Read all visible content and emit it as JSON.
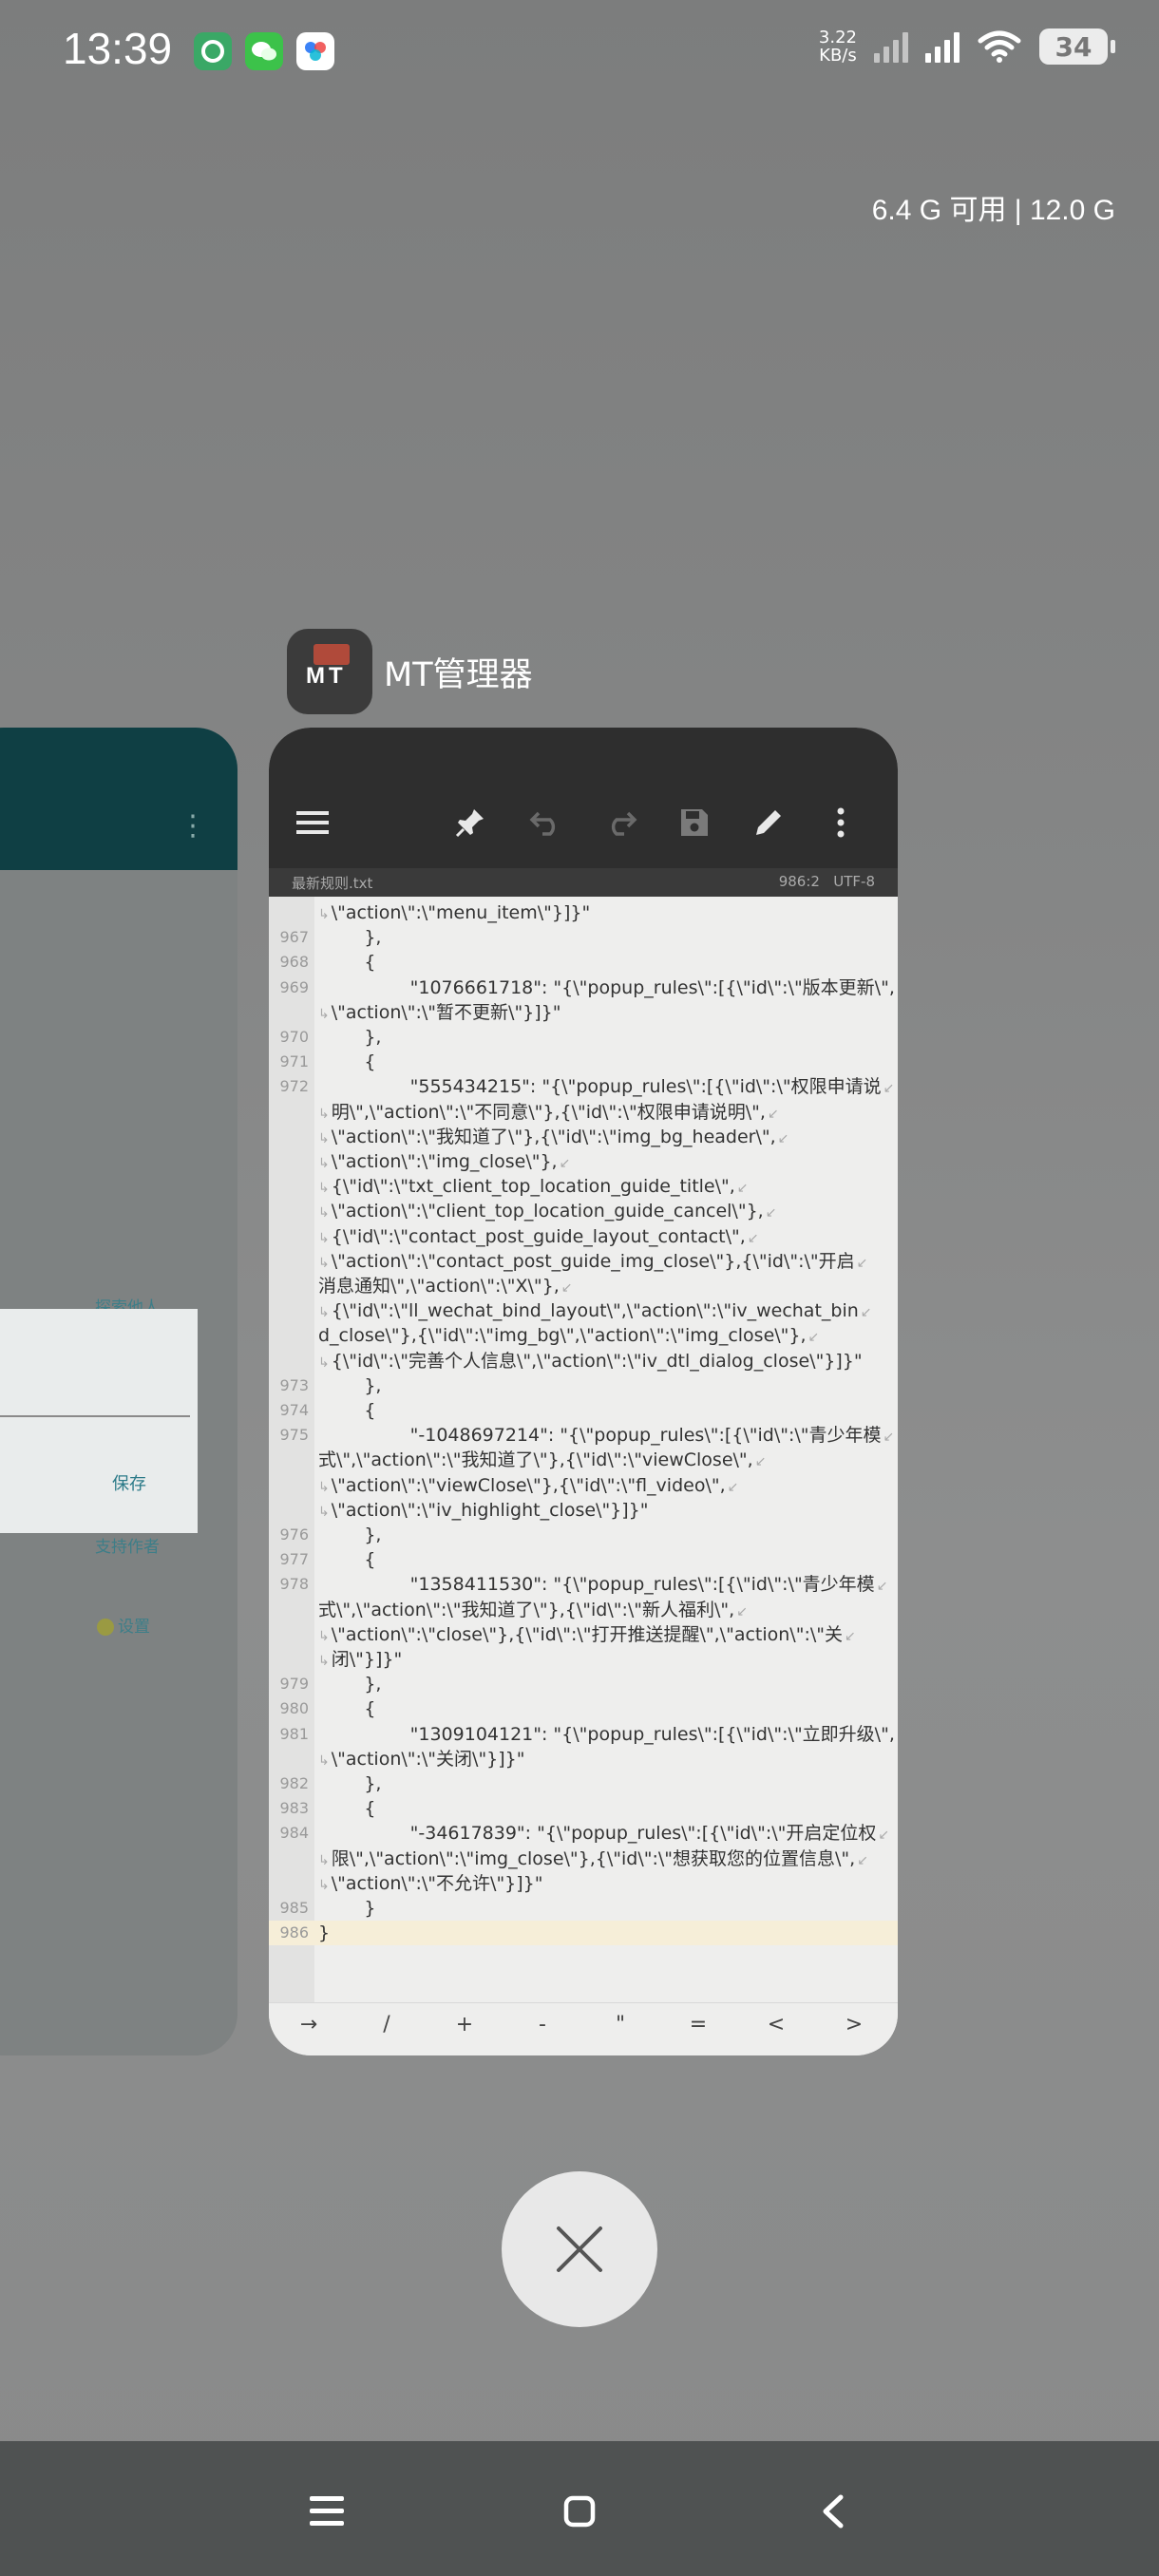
{
  "status_bar": {
    "time": "13:39",
    "app_icons": [
      "green-leaf-icon",
      "wechat-icon",
      "baidu-netdisk-icon"
    ],
    "net_speed_value": "3.22",
    "net_speed_unit": "KB/s",
    "battery": "34"
  },
  "memory": {
    "available": "6.4 G 可用",
    "total": "12.0 G"
  },
  "left_card": {
    "label_1": "探索他人",
    "save_label": "保存",
    "label_2": "支持作者",
    "settings_label": "设置"
  },
  "app": {
    "name": "MT管理器",
    "icon_text": "MT",
    "file_name": "最新规则.txt",
    "cursor_pos": "986:2",
    "encoding": "UTF-8",
    "lines": [
      {
        "n": "",
        "text": "\\\"action\\\":\\\"menu_item\\\"}]}\"",
        "wrap": true,
        "wrapEnd": false
      },
      {
        "n": "967",
        "text": "    },",
        "wrap": false,
        "wrapEnd": false
      },
      {
        "n": "968",
        "text": "    {",
        "wrap": false,
        "wrapEnd": false
      },
      {
        "n": "969",
        "text": "        \"1076661718\": \"{\\\"popup_rules\\\":[{\\\"id\\\":\\\"版本更新\\\",",
        "wrap": false,
        "wrapEnd": true
      },
      {
        "n": "",
        "text": "\\\"action\\\":\\\"暂不更新\\\"}]}\"",
        "wrap": true,
        "wrapEnd": false
      },
      {
        "n": "970",
        "text": "    },",
        "wrap": false,
        "wrapEnd": false
      },
      {
        "n": "971",
        "text": "    {",
        "wrap": false,
        "wrapEnd": false
      },
      {
        "n": "972",
        "text": "        \"555434215\": \"{\\\"popup_rules\\\":[{\\\"id\\\":\\\"权限申请说",
        "wrap": false,
        "wrapEnd": true
      },
      {
        "n": "",
        "text": "明\\\",\\\"action\\\":\\\"不同意\\\"},{\\\"id\\\":\\\"权限申请说明\\\",",
        "wrap": true,
        "wrapEnd": true
      },
      {
        "n": "",
        "text": "\\\"action\\\":\\\"我知道了\\\"},{\\\"id\\\":\\\"img_bg_header\\\",",
        "wrap": true,
        "wrapEnd": true
      },
      {
        "n": "",
        "text": "\\\"action\\\":\\\"img_close\\\"},",
        "wrap": true,
        "wrapEnd": true
      },
      {
        "n": "",
        "text": "{\\\"id\\\":\\\"txt_client_top_location_guide_title\\\",",
        "wrap": true,
        "wrapEnd": true
      },
      {
        "n": "",
        "text": "\\\"action\\\":\\\"client_top_location_guide_cancel\\\"},",
        "wrap": true,
        "wrapEnd": true
      },
      {
        "n": "",
        "text": "{\\\"id\\\":\\\"contact_post_guide_layout_contact\\\",",
        "wrap": true,
        "wrapEnd": true
      },
      {
        "n": "",
        "text": "\\\"action\\\":\\\"contact_post_guide_img_close\\\"},{\\\"id\\\":\\\"开启",
        "wrap": true,
        "wrapEnd": true
      },
      {
        "n": "",
        "text": "消息通知\\\",\\\"action\\\":\\\"X\\\"},",
        "wrap": false,
        "wrapEnd": true
      },
      {
        "n": "",
        "text": "{\\\"id\\\":\\\"ll_wechat_bind_layout\\\",\\\"action\\\":\\\"iv_wechat_bin",
        "wrap": true,
        "wrapEnd": true
      },
      {
        "n": "",
        "text": "d_close\\\"},{\\\"id\\\":\\\"img_bg\\\",\\\"action\\\":\\\"img_close\\\"},",
        "wrap": false,
        "wrapEnd": true
      },
      {
        "n": "",
        "text": "{\\\"id\\\":\\\"完善个人信息\\\",\\\"action\\\":\\\"iv_dtl_dialog_close\\\"}]}\"",
        "wrap": true,
        "wrapEnd": false
      },
      {
        "n": "973",
        "text": "    },",
        "wrap": false,
        "wrapEnd": false
      },
      {
        "n": "974",
        "text": "    {",
        "wrap": false,
        "wrapEnd": false
      },
      {
        "n": "975",
        "text": "        \"-1048697214\": \"{\\\"popup_rules\\\":[{\\\"id\\\":\\\"青少年模",
        "wrap": false,
        "wrapEnd": true
      },
      {
        "n": "",
        "text": "式\\\",\\\"action\\\":\\\"我知道了\\\"},{\\\"id\\\":\\\"viewClose\\\",",
        "wrap": false,
        "wrapEnd": true
      },
      {
        "n": "",
        "text": "\\\"action\\\":\\\"viewClose\\\"},{\\\"id\\\":\\\"fl_video\\\",",
        "wrap": true,
        "wrapEnd": true
      },
      {
        "n": "",
        "text": "\\\"action\\\":\\\"iv_highlight_close\\\"}]}\"",
        "wrap": true,
        "wrapEnd": false
      },
      {
        "n": "976",
        "text": "    },",
        "wrap": false,
        "wrapEnd": false
      },
      {
        "n": "977",
        "text": "    {",
        "wrap": false,
        "wrapEnd": false
      },
      {
        "n": "978",
        "text": "        \"1358411530\": \"{\\\"popup_rules\\\":[{\\\"id\\\":\\\"青少年模",
        "wrap": false,
        "wrapEnd": true
      },
      {
        "n": "",
        "text": "式\\\",\\\"action\\\":\\\"我知道了\\\"},{\\\"id\\\":\\\"新人福利\\\",",
        "wrap": false,
        "wrapEnd": true
      },
      {
        "n": "",
        "text": "\\\"action\\\":\\\"close\\\"},{\\\"id\\\":\\\"打开推送提醒\\\",\\\"action\\\":\\\"关",
        "wrap": true,
        "wrapEnd": true
      },
      {
        "n": "",
        "text": "闭\\\"}]}\"",
        "wrap": true,
        "wrapEnd": false
      },
      {
        "n": "979",
        "text": "    },",
        "wrap": false,
        "wrapEnd": false
      },
      {
        "n": "980",
        "text": "    {",
        "wrap": false,
        "wrapEnd": false
      },
      {
        "n": "981",
        "text": "        \"1309104121\": \"{\\\"popup_rules\\\":[{\\\"id\\\":\\\"立即升级\\\",",
        "wrap": false,
        "wrapEnd": true
      },
      {
        "n": "",
        "text": "\\\"action\\\":\\\"关闭\\\"}]}\"",
        "wrap": true,
        "wrapEnd": false
      },
      {
        "n": "982",
        "text": "    },",
        "wrap": false,
        "wrapEnd": false
      },
      {
        "n": "983",
        "text": "    {",
        "wrap": false,
        "wrapEnd": false
      },
      {
        "n": "984",
        "text": "        \"-34617839\": \"{\\\"popup_rules\\\":[{\\\"id\\\":\\\"开启定位权",
        "wrap": false,
        "wrapEnd": true
      },
      {
        "n": "",
        "text": "限\\\",\\\"action\\\":\\\"img_close\\\"},{\\\"id\\\":\\\"想获取您的位置信息\\\",",
        "wrap": true,
        "wrapEnd": true
      },
      {
        "n": "",
        "text": "\\\"action\\\":\\\"不允许\\\"}]}\"",
        "wrap": true,
        "wrapEnd": false
      },
      {
        "n": "985",
        "text": "    }",
        "wrap": false,
        "wrapEnd": false
      },
      {
        "n": "986",
        "text": "}",
        "wrap": false,
        "wrapEnd": false,
        "highlight": true
      }
    ],
    "symbols": [
      "→",
      "/",
      "+",
      "-",
      "\"",
      "=",
      "<",
      ">"
    ]
  }
}
